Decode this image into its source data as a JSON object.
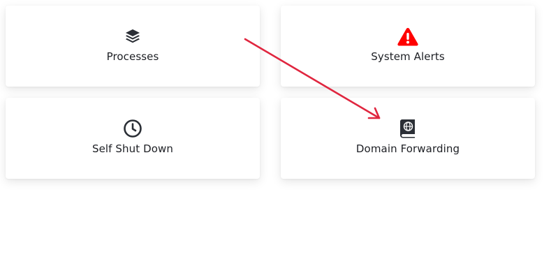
{
  "cards": [
    {
      "label": "Processes",
      "icon": "layers-icon"
    },
    {
      "label": "System Alerts",
      "icon": "warning-triangle-icon",
      "icon_color": "#ff0000"
    },
    {
      "label": "Self Shut Down",
      "icon": "clock-icon"
    },
    {
      "label": "Domain Forwarding",
      "icon": "globe-book-icon"
    }
  ],
  "annotation": {
    "arrow_color": "#e0263f"
  },
  "colors": {
    "icon_dark": "#2b2f36",
    "text": "#1d1f24",
    "background": "#ffffff"
  }
}
